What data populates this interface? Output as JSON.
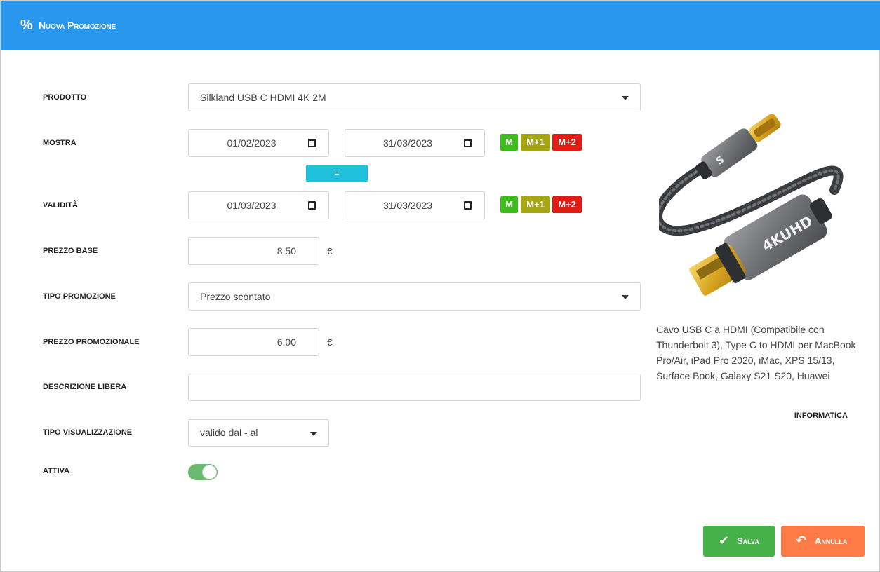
{
  "header": {
    "icon": "%",
    "title": "Nuova Promozione",
    "icon_name": "percent-icon",
    "color": "#2a97ee"
  },
  "form": {
    "prodotto": {
      "label": "Prodotto",
      "value": "Silkland USB C HDMI 4K 2M"
    },
    "mostra": {
      "label": "Mostra",
      "from": "01/02/2023",
      "to": "31/03/2023"
    },
    "copy_button": "=",
    "validita": {
      "label": "Validità",
      "from": "01/03/2023",
      "to": "31/03/2023"
    },
    "badges": {
      "m": "M",
      "m1": "M+1",
      "m2": "M+2"
    },
    "prezzo_base": {
      "label": "Prezzo base",
      "value": "8,50",
      "currency": "€"
    },
    "tipo_promozione": {
      "label": "Tipo promozione",
      "value": "Prezzo scontato"
    },
    "prezzo_promozionale": {
      "label": "Prezzo promozionale",
      "value": "6,00",
      "currency": "€"
    },
    "descrizione_libera": {
      "label": "Descrizione libera",
      "value": ""
    },
    "tipo_visualizzazione": {
      "label": "Tipo visualizzazione",
      "value": "valido dal - al"
    },
    "attiva": {
      "label": "Attiva",
      "on": true
    }
  },
  "product": {
    "image_icon": "usb-c-hdmi-cable-image",
    "image_text": "4KUHD",
    "description": "Cavo USB C a HDMI (Compatibile con Thunderbolt 3), Type C to HDMI per MacBook Pro/Air, iPad Pro 2020, iMac, XPS 15/13, Surface Book, Galaxy S21 S20, Huawei",
    "category": "Informatica"
  },
  "actions": {
    "save_label": "Salva",
    "save_icon": "check-icon",
    "save_color": "#46b148",
    "cancel_label": "Annulla",
    "cancel_icon": "undo-icon",
    "cancel_color": "#fe7a46"
  }
}
